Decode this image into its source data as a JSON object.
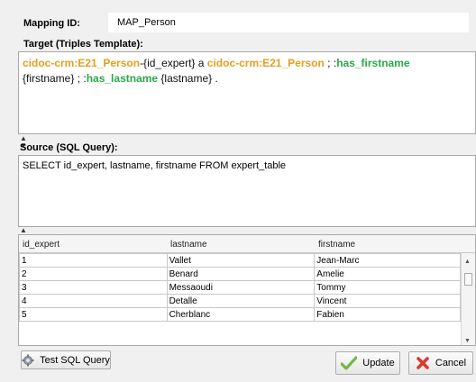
{
  "mapping": {
    "id_label": "Mapping ID:",
    "id_value": "MAP_Person"
  },
  "target": {
    "label": "Target (Triples Template):",
    "line1": [
      {
        "t": "cidoc-crm:E21_Person",
        "c": "kw"
      },
      {
        "t": "-{id_expert} a ",
        "c": "txt"
      },
      {
        "t": "cidoc-crm:E21_Person",
        "c": "kw"
      },
      {
        "t": " ; :",
        "c": "txt"
      },
      {
        "t": "has_firstname",
        "c": "pred"
      }
    ],
    "line2": [
      {
        "t": "{firstname} ; :",
        "c": "txt"
      },
      {
        "t": "has_lastname",
        "c": "pred"
      },
      {
        "t": " {lastname} .",
        "c": "txt"
      }
    ]
  },
  "source": {
    "label": "Source (SQL Query):",
    "query": "SELECT id_expert, lastname, firstname FROM expert_table"
  },
  "table": {
    "columns": [
      "id_expert",
      "lastname",
      "firstname"
    ],
    "rows": [
      [
        "1",
        "Vallet",
        "Jean-Marc"
      ],
      [
        "2",
        "Benard",
        "Amelie"
      ],
      [
        "3",
        "Messaoudi",
        "Tommy"
      ],
      [
        "4",
        "Detalle",
        "Vincent"
      ],
      [
        "5",
        "Cherblanc",
        "Fabien"
      ]
    ]
  },
  "buttons": {
    "test_sql": "Test SQL Query",
    "update": "Update",
    "cancel": "Cancel"
  },
  "colors": {
    "keyword": "#e0a020",
    "predicate": "#2aa84a",
    "update_icon": "#7ab648",
    "cancel_icon": "#d83a2e"
  },
  "icons": {
    "test_sql": "gear-icon",
    "update": "checkmark-icon",
    "cancel": "x-icon"
  }
}
